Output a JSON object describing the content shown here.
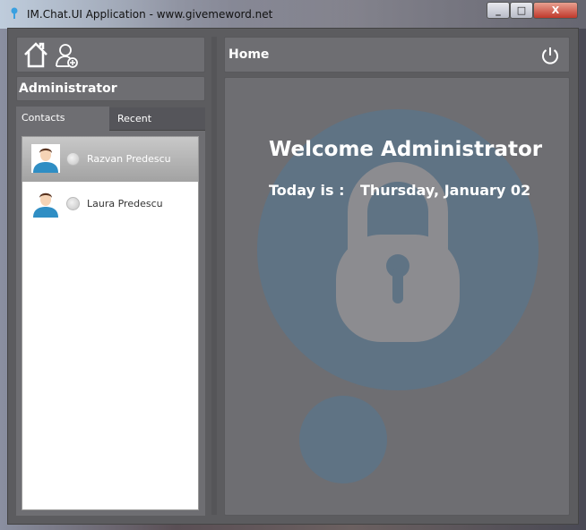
{
  "window": {
    "title": "IM.Chat.UI Application - www.givemeword.net",
    "minimize": "_",
    "maximize": "□",
    "close": "X"
  },
  "sidebar": {
    "user": "Administrator",
    "tabs": [
      {
        "label": "Contacts",
        "active": true
      },
      {
        "label": "Recent",
        "active": false
      }
    ],
    "contacts": [
      {
        "name": "Razvan Predescu",
        "selected": true,
        "status": "offline"
      },
      {
        "name": "Laura Predescu",
        "selected": false,
        "status": "offline"
      }
    ]
  },
  "header": {
    "title": "Home"
  },
  "main": {
    "welcome": "Welcome Administrator",
    "today_label": "Today is :",
    "date": "Thursday, January 02"
  },
  "colors": {
    "panel": "#6e6e72",
    "circle": "#5f7384",
    "lock": "#8c8c90"
  }
}
